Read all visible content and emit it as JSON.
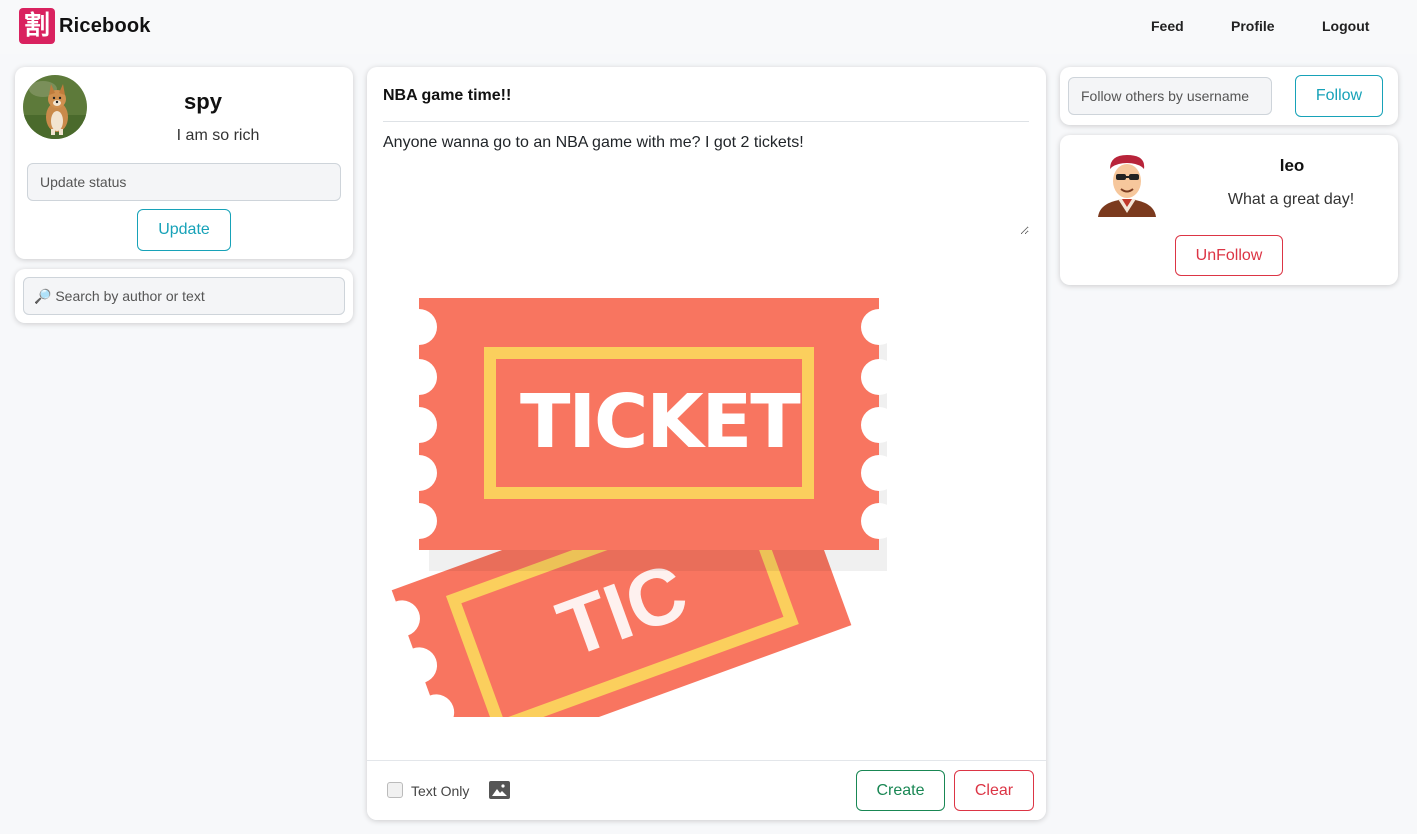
{
  "nav": {
    "logo_glyph": "割",
    "brand": "Ricebook",
    "links": [
      "Feed",
      "Profile",
      "Logout"
    ]
  },
  "profile": {
    "username": "spy",
    "status": "I am so rich",
    "status_placeholder": "Update status",
    "update_label": "Update"
  },
  "search": {
    "placeholder": "🔎 Search by author or text"
  },
  "post": {
    "title": "NBA game time!!",
    "body": "Anyone wanna go to an NBA game with me? I got 2 tickets!",
    "image_text": "TICKET",
    "text_only_label": "Text Only",
    "text_only_checked": false,
    "create_label": "Create",
    "clear_label": "Clear"
  },
  "follow": {
    "placeholder": "Follow others by username",
    "follow_label": "Follow"
  },
  "followers": [
    {
      "username": "leo",
      "status": "What a great day!",
      "unfollow_label": "UnFollow"
    }
  ],
  "colors": {
    "brand": "#d9225f",
    "info": "#17a2b8",
    "success": "#198754",
    "danger": "#dc3545",
    "ticket": "#f87560",
    "ticket_frame": "#fbcf5d"
  },
  "icons": [
    "dog-avatar",
    "magnifier-icon",
    "image-icon",
    "cartoon-avatar"
  ]
}
